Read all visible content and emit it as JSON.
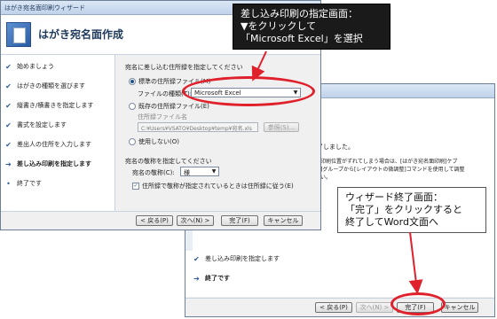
{
  "window1": {
    "title": "はがき宛名面印刷ウィザード",
    "header_title": "はがき宛名面作成",
    "steps": [
      {
        "label": "始めましょう",
        "mark": "✔"
      },
      {
        "label": "はがきの種類を選びます",
        "mark": "✔"
      },
      {
        "label": "縦書き/横書きを指定します",
        "mark": "✔"
      },
      {
        "label": "書式を設定します",
        "mark": "✔"
      },
      {
        "label": "差出人の住所を入力します",
        "mark": "✔"
      },
      {
        "label": "差し込み印刷を指定します",
        "mark": "➔"
      },
      {
        "label": "終了です",
        "mark": "•"
      }
    ],
    "section_address": "宛名に差し込む住所録を指定してください",
    "radio_standard": "標準の住所録ファイル(M)",
    "file_type_label": "ファイルの種類(T):",
    "file_type_value": "Microsoft Excel",
    "radio_existing": "既存の住所録ファイル(E)",
    "address_file_label": "住所録ファイル名",
    "address_file_value": "C:¥Users¥VSATO¥Desktop¥temp¥宛名.xls",
    "browse_label": "参照(S)...",
    "radio_none": "使用しない(O)",
    "section_honorific": "宛名の敬称を指定してください",
    "honorific_label": "宛名の敬称(C):",
    "honorific_value": "様",
    "checkbox_label": "住所録で敬称が指定されているときは住所録に従う(E)",
    "back_label": "< 戻る(P)",
    "next_label": "次へ(N) >",
    "finish_label": "完了(F)",
    "cancel_label": "キャンセル"
  },
  "window2": {
    "line1": "は終了しました。",
    "line2": "さへの印刷位置がずれてしまう場合は、[はがき宛名面印刷]ケブ",
    "line3": "宛名面]グループから[レイアウトの微調整]コマンドを使用して調整",
    "line4": "ください。",
    "step_label": "差し込み印刷を指定します",
    "step_mark": "✔",
    "step_current": "終了です",
    "step_current_mark": "➔",
    "back_label": "< 戻る(P)",
    "next_label": "次へ(N) >",
    "finish_label": "完了(F)",
    "cancel_label": "キャンセル"
  },
  "callout1": {
    "line1": "差し込み印刷の指定画面：",
    "line2": "▼をクリックして",
    "line3": "「Microsoft Excel」を選択"
  },
  "callout2": {
    "line1": "ウィザード終了画面：",
    "line2": "「完了」をクリックすると",
    "line3": "終了してWord文面へ"
  },
  "colors": {
    "highlight": "#e0202a",
    "accent": "#1e395b"
  }
}
